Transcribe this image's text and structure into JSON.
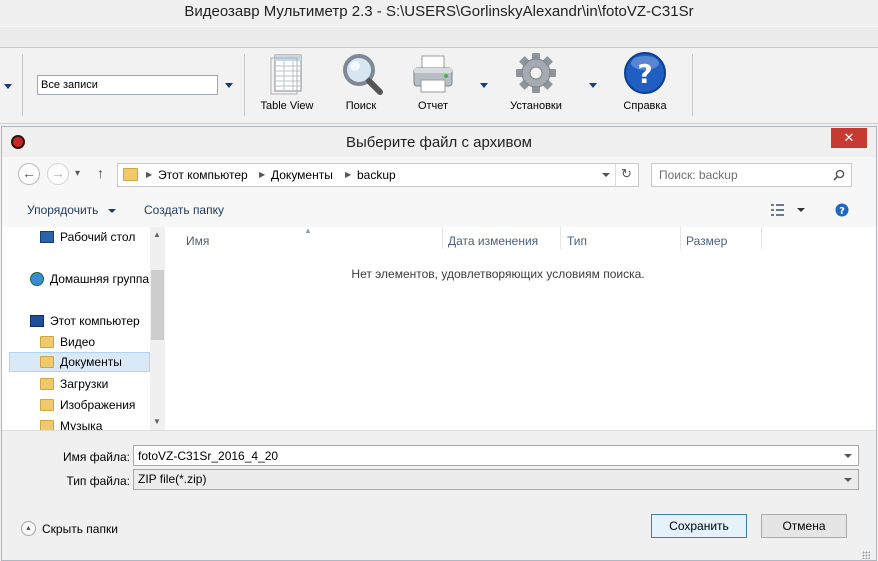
{
  "app": {
    "title": "Видеозавр Мультиметр 2.3 - S:\\USERS\\GorlinskyAlexandr\\in\\fotoVZ-C31Sr",
    "filter_value": "Все записи",
    "toolbar": {
      "table_view": "Table View",
      "search": "Поиск",
      "report": "Отчет",
      "settings": "Установки",
      "help": "Справка"
    }
  },
  "dialog": {
    "title": "Выберите файл с архивом",
    "close_glyph": "✕",
    "nav": {
      "back_glyph": "←",
      "forward_glyph": "→",
      "recent_glyph": "▾",
      "up_glyph": "↑",
      "refresh_glyph": "↻",
      "breadcrumb": [
        "Этот компьютер",
        "Документы",
        "backup"
      ],
      "search_placeholder": "Поиск: backup"
    },
    "commands": {
      "organize": "Упорядочить",
      "new_folder": "Создать папку"
    },
    "sidebar": {
      "items": [
        {
          "label": "Рабочий стол"
        },
        {
          "label": "Домашняя группа"
        },
        {
          "label": "Этот компьютер"
        },
        {
          "label": "Видео"
        },
        {
          "label": "Документы"
        },
        {
          "label": "Загрузки"
        },
        {
          "label": "Изображения"
        },
        {
          "label": "Музыка"
        }
      ]
    },
    "columns": [
      "Имя",
      "Дата изменения",
      "Тип",
      "Размер"
    ],
    "empty_message": "Нет элементов, удовлетворяющих условиям поиска.",
    "filename_label": "Имя файла:",
    "filename_value": "fotoVZ-C31Sr_2016_4_20",
    "filetype_label": "Тип файла:",
    "filetype_value": "ZIP file(*.zip)",
    "hide_folders": "Скрыть папки",
    "save_button": "Сохранить",
    "cancel_button": "Отмена"
  }
}
